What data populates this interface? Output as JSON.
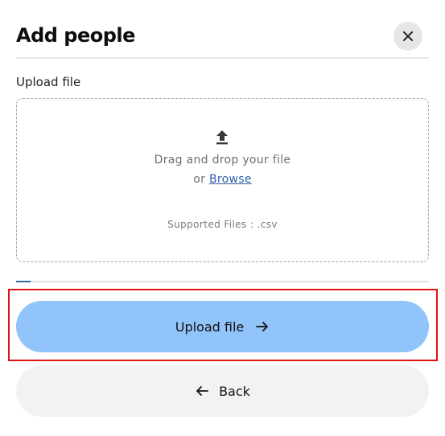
{
  "dialog": {
    "title": "Add people"
  },
  "upload": {
    "label": "Upload file",
    "drag_text": "Drag and drop your file",
    "or_text": "or",
    "browse_label": "Browse",
    "supported_text": "Supported Files : .csv"
  },
  "progress": {
    "fraction": 0.035
  },
  "buttons": {
    "upload_label": "Upload file",
    "back_label": "Back"
  },
  "icons": {
    "close": "close-icon",
    "upload": "upload-icon",
    "arrow_right": "arrow-right-icon",
    "arrow_left": "arrow-left-icon"
  },
  "colors": {
    "primary_button": "#90c4fa",
    "secondary_button": "#f2f2f2",
    "link": "#2e5fa8",
    "progress": "#2e63a8",
    "highlight": "#e01212"
  }
}
